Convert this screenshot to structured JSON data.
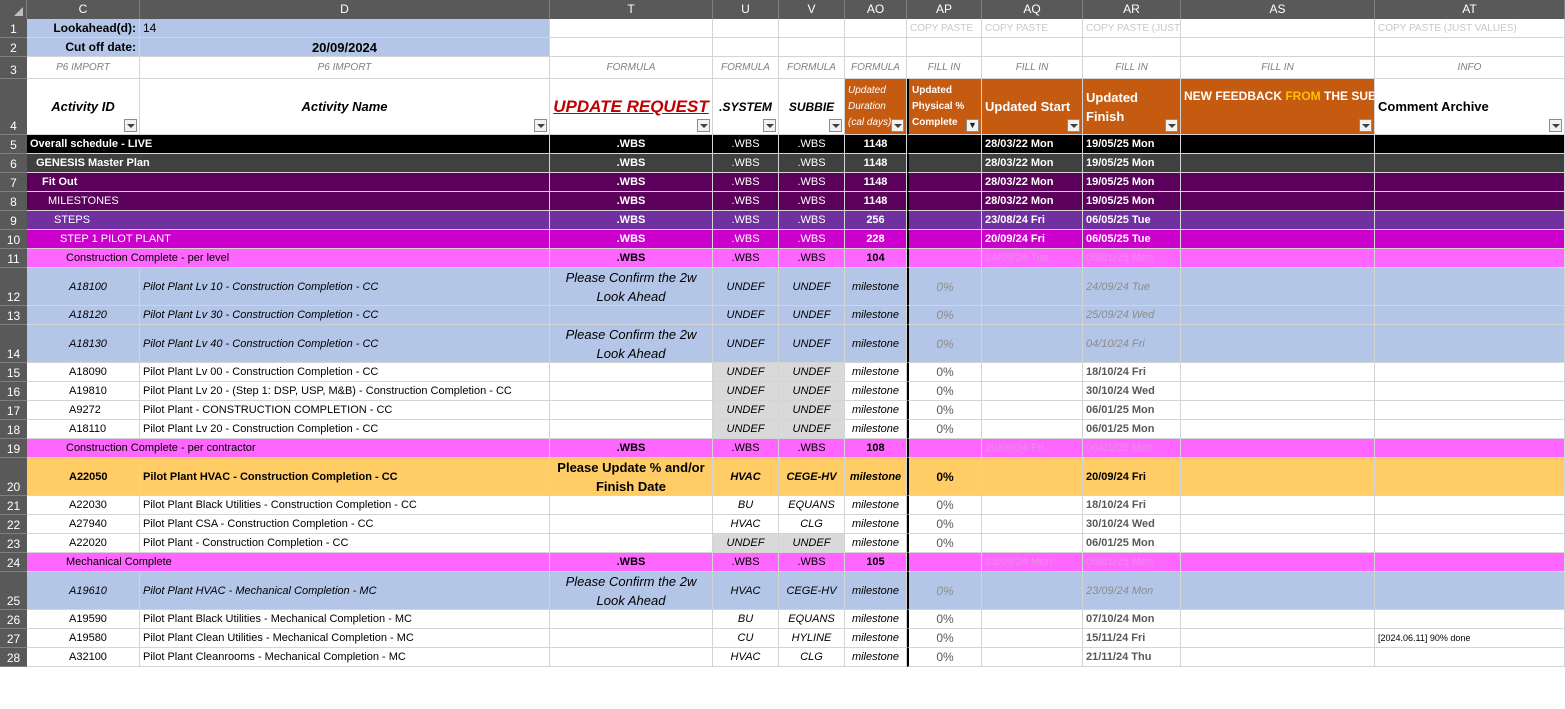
{
  "columns": [
    {
      "id": "C",
      "w": 113
    },
    {
      "id": "D",
      "w": 410
    },
    {
      "id": "T",
      "w": 163
    },
    {
      "id": "U",
      "w": 66
    },
    {
      "id": "V",
      "w": 66
    },
    {
      "id": "AO",
      "w": 62
    },
    {
      "id": "AP",
      "w": 75
    },
    {
      "id": "AQ",
      "w": 101
    },
    {
      "id": "AR",
      "w": 98
    },
    {
      "id": "AS",
      "w": 194
    },
    {
      "id": "AT",
      "w": 190
    }
  ],
  "rows": [
    "1",
    "2",
    "3",
    "4",
    "5",
    "6",
    "7",
    "8",
    "9",
    "10",
    "11",
    "12",
    "13",
    "14",
    "15",
    "16",
    "17",
    "18",
    "19",
    "20",
    "21",
    "22",
    "23",
    "24",
    "25",
    "26",
    "27",
    "28"
  ],
  "params": {
    "lookahead_label": "Lookahead(d):",
    "lookahead_value": "14",
    "cutoff_label": "Cut off date:",
    "cutoff_value": "20/09/2024"
  },
  "row1": {
    "AP": "COPY PASTE",
    "AQ": "COPY PASTE",
    "AR": "COPY PASTE (JUST VALUES)",
    "AT": "COPY PASTE (JUST VALUES)"
  },
  "row3": {
    "C": "P6 IMPORT",
    "D": "P6 IMPORT",
    "T": "FORMULA",
    "U": "FORMULA",
    "V": "FORMULA",
    "AO": "FORMULA",
    "AP": "FILL IN",
    "AQ": "FILL IN",
    "AR": "FILL IN",
    "AS": "FILL IN",
    "AT": "INFO"
  },
  "headers": {
    "C": "Activity ID",
    "D": "Activity Name",
    "T": "UPDATE REQUEST",
    "U": ".SYSTEM",
    "V": "SUBBIE",
    "AO": "Updated Duration (cal days)",
    "AP": "Updated Physical % Complete",
    "AQ": "Updated Start",
    "AR": "Updated Finish",
    "AS_a": "NEW FEEDBACK ",
    "AS_b": "FROM",
    "AS_c": " THE SUBCONTRACTOR",
    "AT": "Comment Archive"
  },
  "data_rows": [
    {
      "C": "Overall schedule - LIVE",
      "T": ".WBS",
      "U": ".WBS",
      "V": ".WBS",
      "AO": "1148",
      "AQ": "28/03/22 Mon",
      "AR": "19/05/25 Mon",
      "AT": ""
    },
    {
      "C": "GENESIS Master Plan",
      "T": ".WBS",
      "U": ".WBS",
      "V": ".WBS",
      "AO": "1148",
      "AQ": "28/03/22 Mon",
      "AR": "19/05/25 Mon"
    },
    {
      "C": "Fit Out",
      "T": ".WBS",
      "U": ".WBS",
      "V": ".WBS",
      "AO": "1148",
      "AQ": "28/03/22 Mon",
      "AR": "19/05/25 Mon"
    },
    {
      "C": "MILESTONES",
      "T": ".WBS",
      "U": ".WBS",
      "V": ".WBS",
      "AO": "1148",
      "AQ": "28/03/22 Mon",
      "AR": "19/05/25 Mon"
    },
    {
      "C": "STEPS",
      "T": ".WBS",
      "U": ".WBS",
      "V": ".WBS",
      "AO": "256",
      "AQ": "23/08/24 Fri",
      "AR": "06/05/25 Tue"
    },
    {
      "C": "STEP 1 PILOT PLANT",
      "T": ".WBS",
      "U": ".WBS",
      "V": ".WBS",
      "AO": "228",
      "AQ": "20/09/24 Fri",
      "AR": "06/05/25 Tue"
    },
    {
      "C": "Construction Complete - per level",
      "T": ".WBS",
      "U": ".WBS",
      "V": ".WBS",
      "AO": "104",
      "AQ": "24/09/24 Tue",
      "AR": "06/01/25 Mon"
    },
    {
      "C": "A18100",
      "D": "Pilot Plant Lv 10 - Construction Completion - CC",
      "T": "Please Confirm the 2w Look Ahead",
      "U": "UNDEF",
      "V": "UNDEF",
      "AO": "milestone",
      "AP": "0%",
      "AR": "24/09/24 Tue"
    },
    {
      "C": "A18120",
      "D": "Pilot Plant Lv 30 - Construction Completion - CC",
      "T": "",
      "U": "UNDEF",
      "V": "UNDEF",
      "AO": "milestone",
      "AP": "0%",
      "AR": "25/09/24 Wed"
    },
    {
      "C": "A18130",
      "D": "Pilot Plant Lv 40 - Construction Completion - CC",
      "T": "Please Confirm the 2w Look Ahead",
      "U": "UNDEF",
      "V": "UNDEF",
      "AO": "milestone",
      "AP": "0%",
      "AR": "04/10/24 Fri"
    },
    {
      "C": "A18090",
      "D": "Pilot Plant Lv 00 - Construction Completion - CC",
      "U": "UNDEF",
      "V": "UNDEF",
      "AO": "milestone",
      "AP": "0%",
      "AR": "18/10/24 Fri"
    },
    {
      "C": "A19810",
      "D": "Pilot Plant Lv 20 - (Step 1: DSP, USP, M&B) - Construction Completion - CC",
      "U": "UNDEF",
      "V": "UNDEF",
      "AO": "milestone",
      "AP": "0%",
      "AR": "30/10/24 Wed"
    },
    {
      "C": "A9272",
      "D": "Pilot Plant - CONSTRUCTION COMPLETION - CC",
      "U": "UNDEF",
      "V": "UNDEF",
      "AO": "milestone",
      "AP": "0%",
      "AR": "06/01/25 Mon"
    },
    {
      "C": "A18110",
      "D": "Pilot Plant Lv 20 - Construction Completion - CC",
      "U": "UNDEF",
      "V": "UNDEF",
      "AO": "milestone",
      "AP": "0%",
      "AR": "06/01/25 Mon"
    },
    {
      "C": "Construction Complete - per contractor",
      "T": ".WBS",
      "U": ".WBS",
      "V": ".WBS",
      "AO": "108",
      "AQ": "20/09/24 Fri",
      "AR": "06/01/25 Mon"
    },
    {
      "C": "A22050",
      "D": "Pilot Plant HVAC - Construction Completion - CC",
      "T": "Please Update % and/or Finish Date",
      "U": "HVAC",
      "V": "CEGE-HV",
      "AO": "milestone",
      "AP": "0%",
      "AR": "20/09/24 Fri"
    },
    {
      "C": "A22030",
      "D": "Pilot Plant Black Utilities - Construction Completion - CC",
      "U": "BU",
      "V": "EQUANS",
      "AO": "milestone",
      "AP": "0%",
      "AR": "18/10/24 Fri"
    },
    {
      "C": "A27940",
      "D": "Pilot Plant CSA - Construction Completion - CC",
      "U": "HVAC",
      "V": "CLG",
      "AO": "milestone",
      "AP": "0%",
      "AR": "30/10/24 Wed"
    },
    {
      "C": "A22020",
      "D": "Pilot Plant - Construction Completion - CC",
      "U": "UNDEF",
      "V": "UNDEF",
      "AO": "milestone",
      "AP": "0%",
      "AR": "06/01/25 Mon"
    },
    {
      "C": "Mechanical Complete",
      "T": ".WBS",
      "U": ".WBS",
      "V": ".WBS",
      "AO": "105",
      "AQ": "23/09/24 Mon",
      "AR": "06/01/25 Mon"
    },
    {
      "C": "A19610",
      "D": "Pilot Plant HVAC - Mechanical Completion - MC",
      "T": "Please Confirm the 2w Look Ahead",
      "U": "HVAC",
      "V": "CEGE-HV",
      "AO": "milestone",
      "AP": "0%",
      "AR": "23/09/24 Mon"
    },
    {
      "C": "A19590",
      "D": "Pilot Plant Black Utilities - Mechanical Completion - MC",
      "U": "BU",
      "V": "EQUANS",
      "AO": "milestone",
      "AP": "0%",
      "AR": "07/10/24 Mon"
    },
    {
      "C": "A19580",
      "D": "Pilot Plant Clean Utilities - Mechanical Completion - MC",
      "U": "CU",
      "V": "HYLINE",
      "AO": "milestone",
      "AP": "0%",
      "AR": "15/11/24 Fri",
      "AT": "[2024.06.11] 90% done"
    },
    {
      "C": "A32100",
      "D": "Pilot Plant Cleanrooms - Mechanical Completion - MC",
      "U": "HVAC",
      "V": "CLG",
      "AO": "milestone",
      "AP": "0%",
      "AR": "21/11/24 Thu"
    }
  ],
  "colors": {
    "header_gray": "#595959",
    "param_blue": "#b4c6e7",
    "orange": "#c55a11",
    "update_red": "#c00000",
    "black_row": "#000000",
    "gray_row": "#404040",
    "purple1": "#5b005b",
    "purple2": "#7030a0",
    "purple3": "#9900cc",
    "magenta": "#cc00cc",
    "pink": "#ff66ff",
    "lightblue": "#b4c6e7",
    "amber": "#ffcc66",
    "undef_gray": "#d9d9d9"
  }
}
